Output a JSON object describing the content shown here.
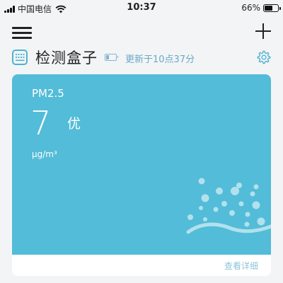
{
  "status_bar": {
    "carrier": "中国电信",
    "time": "10:37",
    "battery": "66%",
    "battery_level": 0.66
  },
  "nav": {
    "menu_icon": "hamburger-menu-icon",
    "add_icon": "plus-icon"
  },
  "device": {
    "name": "检测盒子",
    "update_text": "更新于10点37分",
    "device_icon": "sensor-box-icon",
    "battery_icon": "battery-low-icon",
    "settings_icon": "gear-icon"
  },
  "reading": {
    "label": "PM2.5",
    "value": "7",
    "level": "优",
    "unit": "μg/m³",
    "detail_link": "查看详细"
  },
  "colors": {
    "card": "#53bcd8",
    "accent": "#6aa9c5",
    "background": "#f3f4f6"
  }
}
